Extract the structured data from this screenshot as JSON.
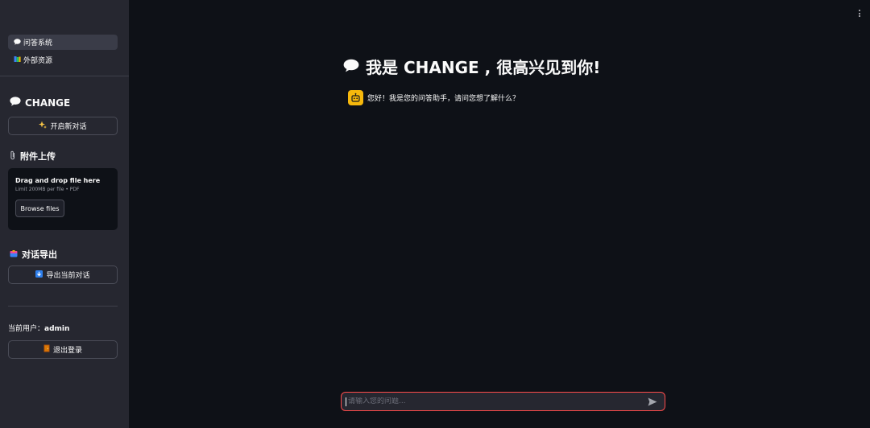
{
  "nav": {
    "items": [
      {
        "label": "问答系统",
        "icon": "speech-bubble-icon",
        "active": true
      },
      {
        "label": "外部资源",
        "icon": "books-icon",
        "active": false
      }
    ]
  },
  "sidebar": {
    "brand": "CHANGE",
    "new_chat_label": "开启新对话",
    "upload_heading": "附件上传",
    "uploader": {
      "title": "Drag and drop file here",
      "limit": "Limit 200MB per file • PDF",
      "browse_label": "Browse files"
    },
    "export_heading": "对话导出",
    "export_label": "导出当前对话",
    "user_prefix": "当前用户：",
    "username": "admin",
    "logout_label": "退出登录"
  },
  "main": {
    "title": "我是 CHANGE , 很高兴见到你!",
    "messages": [
      {
        "role": "assistant",
        "avatar": "robot-icon",
        "text": "您好！我是您的问答助手，请问您想了解什么？"
      }
    ]
  },
  "chat_input": {
    "placeholder": "请输入您的问题...",
    "value": ""
  },
  "colors": {
    "background": "#0e1117",
    "sidebar": "#262730",
    "accent": "#ff4b4b",
    "avatar": "#f6b80c"
  }
}
